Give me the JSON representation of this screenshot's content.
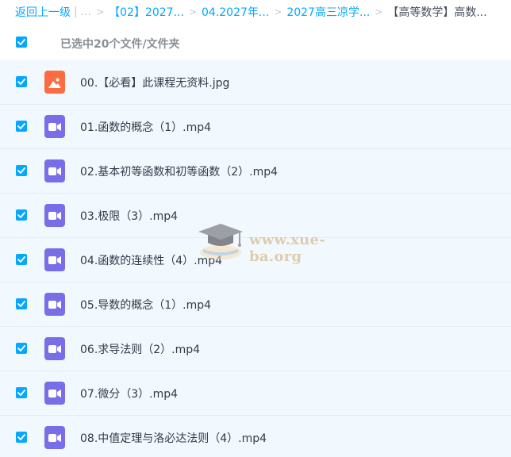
{
  "breadcrumb": {
    "back_label": "返回上一级",
    "pipe": "|",
    "ellipsis": "...",
    "separator": ">",
    "items": [
      "【02】2027...",
      "04.2027年...",
      "2027高三凉学..."
    ],
    "current": "【高等数学】高数..."
  },
  "selection": {
    "summary": "已选中20个文件/文件夹",
    "checked": true
  },
  "files": [
    {
      "name": "00.【必看】此课程无资料.jpg",
      "type": "image",
      "icon": "image-file-icon",
      "checked": true
    },
    {
      "name": "01.函数的概念（1）.mp4",
      "type": "video",
      "icon": "video-file-icon",
      "checked": true
    },
    {
      "name": "02.基本初等函数和初等函数（2）.mp4",
      "type": "video",
      "icon": "video-file-icon",
      "checked": true
    },
    {
      "name": "03.极限（3）.mp4",
      "type": "video",
      "icon": "video-file-icon",
      "checked": true
    },
    {
      "name": "04.函数的连续性（4）.mp4",
      "type": "video",
      "icon": "video-file-icon",
      "checked": true
    },
    {
      "name": "05.导数的概念（1）.mp4",
      "type": "video",
      "icon": "video-file-icon",
      "checked": true
    },
    {
      "name": "06.求导法则（2）.mp4",
      "type": "video",
      "icon": "video-file-icon",
      "checked": true
    },
    {
      "name": "07.微分（3）.mp4",
      "type": "video",
      "icon": "video-file-icon",
      "checked": true
    },
    {
      "name": "08.中值定理与洛必达法则（4）.mp4",
      "type": "video",
      "icon": "video-file-icon",
      "checked": true
    }
  ],
  "watermark": {
    "text": "www.xue-ba.org",
    "icon": "graduation-cap-icon"
  },
  "colors": {
    "accent": "#06a7ff",
    "row_background": "#f1f8fe",
    "video_icon": "#7a6ee8",
    "image_icon": "#fd6b40"
  }
}
